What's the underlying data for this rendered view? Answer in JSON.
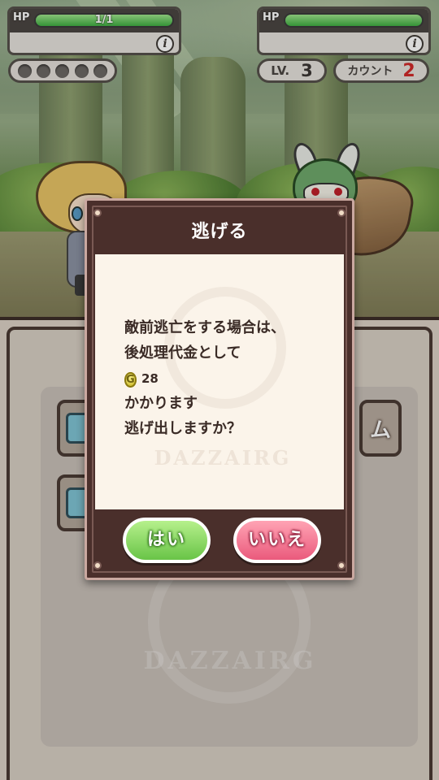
{
  "player": {
    "hp_label": "HP",
    "hp_text": "1/1",
    "hp_fraction": 1.0,
    "info_icon": "info-icon",
    "pips": 5
  },
  "enemy": {
    "hp_label": "HP",
    "hp_fraction": 1.0,
    "info_icon": "info-icon"
  },
  "level": {
    "label": "LV.",
    "value": "3"
  },
  "count": {
    "label": "カウント",
    "value": "2"
  },
  "menu": {
    "attack_icon": "sword-icon",
    "flee_icon": "running-figure-icon",
    "item_partial_label": "ム",
    "watermark_text": "DAZZAIRG"
  },
  "dialog": {
    "title": "逃げる",
    "lines": [
      "敵前逃亡をする場合は、",
      "後処理代金として"
    ],
    "coin_icon": "G",
    "coin_amount": "28",
    "lines_after": [
      "かかります",
      "逃げ出しますか？"
    ],
    "watermark_text": "DAZZAIRG",
    "yes_label": "はい",
    "no_label": "いいえ"
  },
  "colors": {
    "dialog_frame": "#4a2f2b",
    "yes_button": "#69c447",
    "no_button": "#ea5a7c",
    "hp_fill": "#3fae42",
    "count_value": "#d12a2a"
  }
}
